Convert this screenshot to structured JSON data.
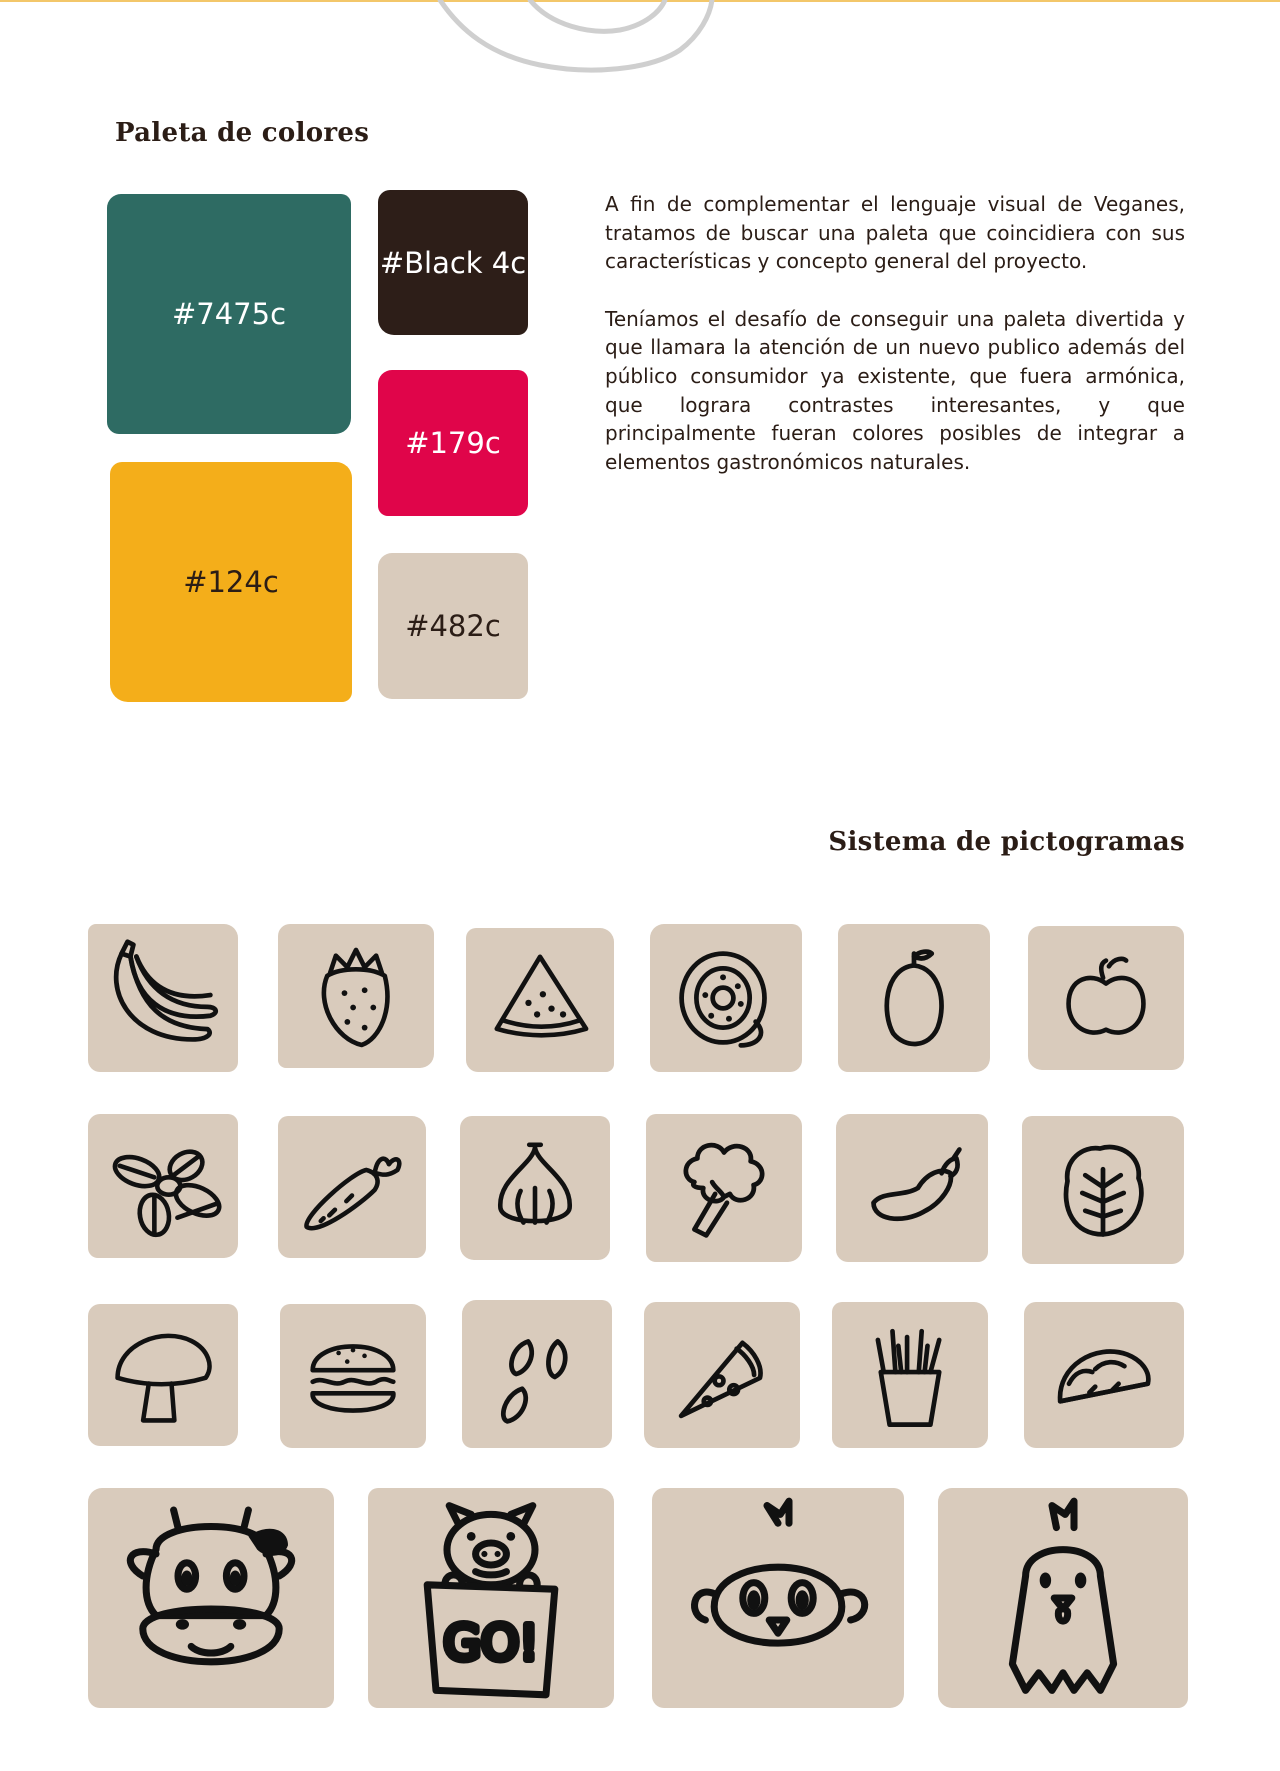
{
  "palette": {
    "title": "Paleta de colores",
    "swatches": [
      {
        "label": "#7475c",
        "color": "#2e6b63",
        "text_color": "#ffffff"
      },
      {
        "label": "#Black 4c",
        "color": "#2d1e18",
        "text_color": "#ffffff"
      },
      {
        "label": "#179c",
        "color": "#e0054a",
        "text_color": "#ffffff"
      },
      {
        "label": "#124c",
        "color": "#f4ae1a",
        "text_color": "#2b1d16"
      },
      {
        "label": "#482c",
        "color": "#d9cbbc",
        "text_color": "#2b1d16"
      }
    ]
  },
  "description": {
    "paragraph_1": "A fin de complementar el lenguaje visual de Veganes, tratamos de buscar una paleta que coincidiera con sus características y concepto general del proyecto.",
    "paragraph_2": "Teníamos el desafío de conseguir una paleta divertida y que llamara la atención de un nuevo publico además del público consumidor ya existente, que fuera armónica, que lograra contrastes interesantes, y que principalmente fueran colores posibles de integrar a elementos gastronómicos naturales."
  },
  "pictograms": {
    "title": "Sistema de pictogramas",
    "tile_color": "#d9cbbc",
    "icons": [
      "banana-icon",
      "strawberry-icon",
      "watermelon-icon",
      "kiwi-icon",
      "plum-icon",
      "apple-icon",
      "basil-icon",
      "carrot-icon",
      "garlic-icon",
      "broccoli-icon",
      "eggplant-icon",
      "lettuce-icon",
      "mushroom-icon",
      "burger-icon",
      "seeds-icon",
      "pizza-icon",
      "fries-icon",
      "taco-icon",
      "cow-icon",
      "pig-icon",
      "chick-icon",
      "hen-icon"
    ],
    "sign_text": "GO!"
  }
}
